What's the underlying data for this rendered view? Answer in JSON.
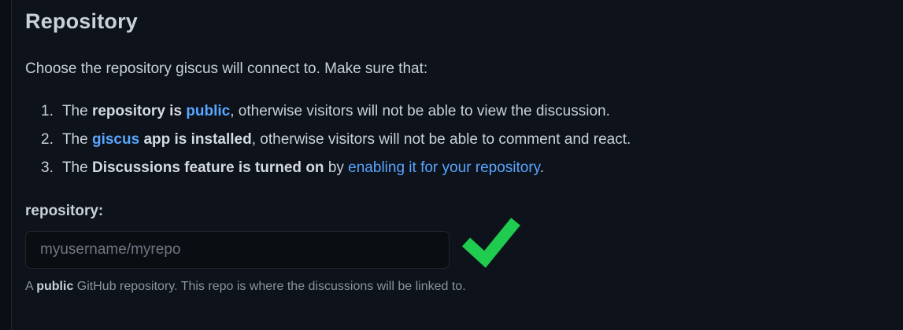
{
  "section": {
    "title": "Repository",
    "intro": "Choose the repository giscus will connect to. Make sure that:"
  },
  "requirements": [
    {
      "number": "1.",
      "prefix": "The ",
      "bold": "repository is ",
      "link": "public",
      "suffix": ", otherwise visitors will not be able to view the discussion."
    },
    {
      "number": "2.",
      "prefix": "The ",
      "link": "giscus",
      "bold": " app is installed",
      "suffix": ", otherwise visitors will not be able to comment and react."
    },
    {
      "number": "3.",
      "prefix": "The ",
      "bold": "Discussions feature is turned on",
      "middle": " by ",
      "link": "enabling it for your repository",
      "suffix": "."
    }
  ],
  "field": {
    "label": "repository:",
    "value": "",
    "placeholder": "myusername/myrepo",
    "valid": true,
    "status_icon": "check-icon",
    "status_color": "#1fcc4f"
  },
  "help": {
    "prefix": "A ",
    "bold": "public",
    "suffix": " GitHub repository. This repo is where the discussions will be linked to."
  },
  "colors": {
    "link": "#58a6ff",
    "background": "#0e121a",
    "text": "#c9d1d9",
    "muted": "#8b949e"
  }
}
